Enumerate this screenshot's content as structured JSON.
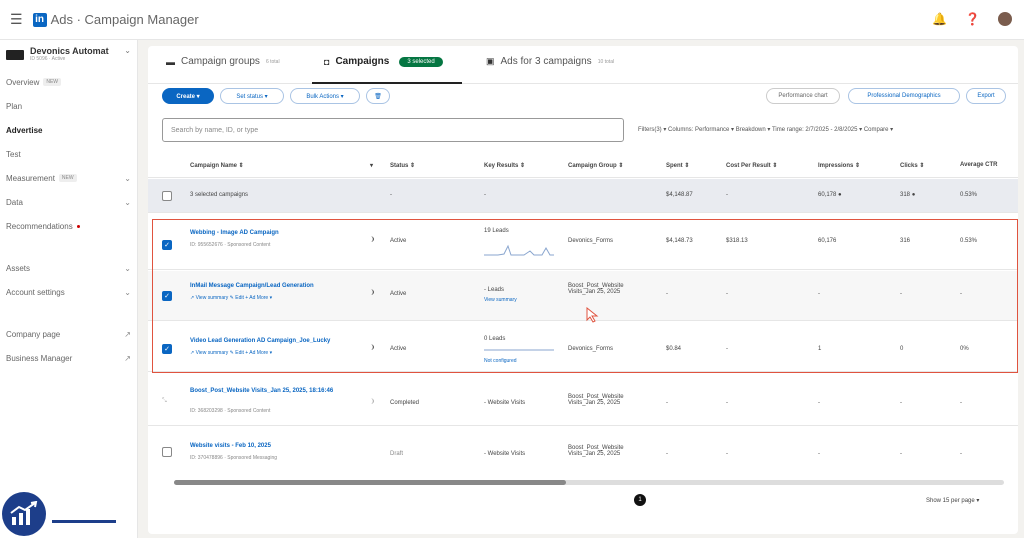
{
  "topbar": {
    "app_title": "Ads · Campaign Manager",
    "logo_text": "in"
  },
  "account": {
    "name": "Devonics Automat",
    "sub": "ID 5096 · Active"
  },
  "nav": [
    {
      "label": "Overview",
      "badge": "NEW"
    },
    {
      "label": "Plan"
    },
    {
      "label": "Advertise",
      "active": true
    },
    {
      "label": "Test"
    },
    {
      "label": "Measurement",
      "badge": "NEW"
    },
    {
      "label": "Data"
    },
    {
      "label": "Recommendations"
    },
    {
      "label": "Assets"
    },
    {
      "label": "Account settings"
    },
    {
      "label": "Company page"
    },
    {
      "label": "Business Manager"
    }
  ],
  "tabs": {
    "groups": {
      "label": "Campaign groups",
      "count": "6 total"
    },
    "campaigns": {
      "label": "Campaigns",
      "pill": "3 selected"
    },
    "ads": {
      "label": "Ads for 3 campaigns",
      "count": "10 total"
    }
  },
  "toolbar": {
    "create": "Create ▾",
    "set_status": "Set status ▾",
    "bulk_actions": "Bulk Actions ▾",
    "delete": "🗑",
    "performance_chart": "Performance chart",
    "demographics": "Professional Demographics",
    "export": "Export"
  },
  "search": {
    "placeholder": "Search by name, ID, or type"
  },
  "filters": "Filters(3) ▾   Columns: Performance ▾   Breakdown ▾   Time range: 2/7/2025 - 2/8/2025 ▾   Compare ▾",
  "columns": {
    "name": "Campaign Name",
    "status": "Status",
    "key_results": "Key Results",
    "group": "Campaign Group",
    "spent": "Spent",
    "cpr": "Cost Per Result",
    "impressions": "Impressions",
    "clicks": "Clicks",
    "ctr": "Average CTR"
  },
  "summary_row": {
    "label": "3 selected campaigns",
    "status": "-",
    "key_results": "-",
    "spent": "$4,148.87",
    "cpr": "-",
    "impressions": "60,178",
    "clicks": "318",
    "ctr": "0.53%"
  },
  "rows": [
    {
      "name": "Webbing - Image AD Campaign",
      "sub": "ID: 955652676 · Sponsored Content",
      "status": "Active",
      "key_results": "19 Leads",
      "group": "Devonics_Forms",
      "spent": "$4,148.73",
      "cpr": "$318.13",
      "impressions": "60,176",
      "clicks": "316",
      "ctr": "0.53%"
    },
    {
      "name": "InMail Message Campaign/Lead Generation",
      "sub": "↗ View summary  ✎ Edit  + Ad  More ▾",
      "status": "Active",
      "key_results": "- Leads",
      "kr_link": "View summary",
      "group": "Boost_Post_Website Visits_Jan 25, 2025",
      "spent": "-",
      "cpr": "-",
      "impressions": "-",
      "clicks": "-",
      "ctr": "-"
    },
    {
      "name": "Video Lead Generation AD Campaign_Joe_Lucky",
      "sub": "↗ View summary  ✎ Edit  + Ad  More ▾",
      "status": "Active",
      "key_results": "0 Leads",
      "kr_link": "Not configured",
      "group": "Devonics_Forms",
      "spent": "$0.84",
      "cpr": "-",
      "impressions": "1",
      "clicks": "0",
      "ctr": "0%"
    },
    {
      "name": "Boost_Post_Website Visits_Jan 25, 2025, 18:16:46",
      "sub": "ID: 368203298 · Sponsored Content",
      "status": "Completed",
      "key_results": "- Website Visits",
      "group": "Boost_Post_Website Visits_Jan 25, 2025",
      "spent": "-",
      "cpr": "-",
      "impressions": "-",
      "clicks": "-",
      "ctr": "-"
    },
    {
      "name": "Website visits - Feb 10, 2025",
      "sub": "ID: 370478896 · Sponsored Messaging",
      "status": "Draft",
      "key_results": "- Website Visits",
      "group": "Boost_Post_Website Visits_Jan 25, 2025",
      "spent": "-",
      "cpr": "-",
      "impressions": "-",
      "clicks": "-",
      "ctr": "-"
    }
  ],
  "pagination": {
    "page": "1",
    "per_page": "Show 15 per page ▾"
  },
  "colors": {
    "accent": "#0a66c2",
    "highlight": "#e0533f",
    "active_pill": "#057642",
    "brand": "#1d3e8a"
  }
}
